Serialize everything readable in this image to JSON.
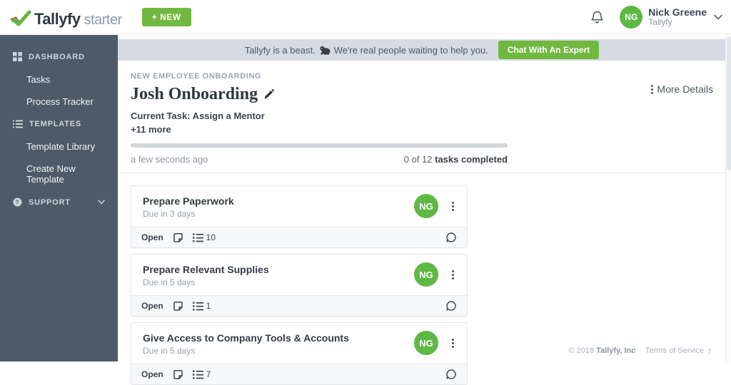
{
  "topbar": {
    "logo_primary": "Tallyfy",
    "logo_secondary": "starter",
    "new_button": "+ NEW",
    "user_name": "Nick Greene",
    "user_org": "Tallyfy",
    "avatar_initials": "NG"
  },
  "sidebar": {
    "items": [
      {
        "label": "DASHBOARD",
        "type": "section",
        "icon": "grid"
      },
      {
        "label": "Tasks",
        "type": "link"
      },
      {
        "label": "Process Tracker",
        "type": "link"
      },
      {
        "label": "TEMPLATES",
        "type": "section",
        "icon": "list"
      },
      {
        "label": "Template Library",
        "type": "link"
      },
      {
        "label": "Create New Template",
        "type": "link"
      },
      {
        "label": "SUPPORT",
        "type": "section",
        "icon": "question",
        "chevron": true
      }
    ]
  },
  "banner": {
    "text_before": "Tallyfy is a beast.",
    "text_after": "We're real people waiting to help you.",
    "button": "Chat With An Expert"
  },
  "header": {
    "breadcrumb": "NEW EMPLOYEE ONBOARDING",
    "title": "Josh Onboarding",
    "more_details": "More Details",
    "current_task": "Current Task: Assign a Mentor",
    "more_tasks": "+11 more",
    "updated": "a few seconds ago",
    "completed_prefix": "0 of 12 ",
    "completed_bold": "tasks completed",
    "progress_percent": 0
  },
  "tasks": [
    {
      "title": "Prepare Paperwork",
      "due": "Due in 3 days",
      "status": "Open",
      "checklist_count": "10",
      "assignee_initials": "NG"
    },
    {
      "title": "Prepare Relevant Supplies",
      "due": "Due in 5 days",
      "status": "Open",
      "checklist_count": "1",
      "assignee_initials": "NG"
    },
    {
      "title": "Give Access to Company Tools & Accounts",
      "due": "Due in 5 days",
      "status": "Open",
      "checklist_count": "7",
      "assignee_initials": "NG"
    }
  ],
  "page_footer": {
    "copyright_prefix": "© 2018",
    "company": "Tallyfy, Inc",
    "separator": "·",
    "terms": "Terms of Service"
  },
  "colors": {
    "brand_green": "#72b840",
    "avatar_green": "#5eb843",
    "sidebar_bg": "#4e5a67",
    "banner_bg": "#d4dbe4"
  }
}
